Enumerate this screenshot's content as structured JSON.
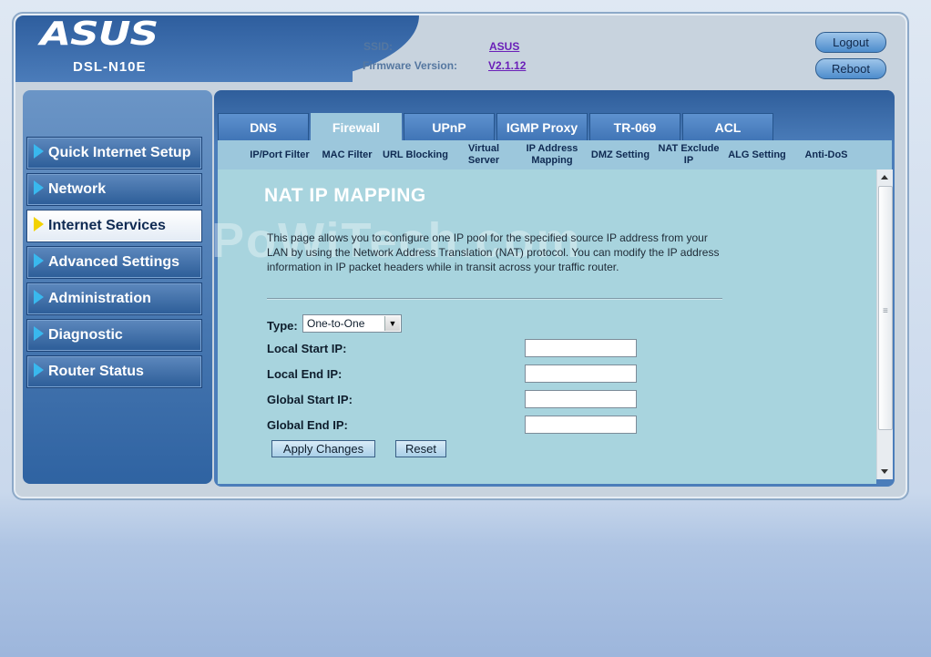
{
  "header": {
    "brand": "ASUS",
    "model": "DSL-N10E",
    "ssid_label": "SSID:",
    "ssid_value": "ASUS",
    "firmware_label": "Firmware Version:",
    "firmware_value": "V2.1.12",
    "logout_label": "Logout",
    "reboot_label": "Reboot"
  },
  "sidebar": {
    "items": [
      {
        "label": "Quick Internet Setup"
      },
      {
        "label": "Network"
      },
      {
        "label": "Internet Services"
      },
      {
        "label": "Advanced Settings"
      },
      {
        "label": "Administration"
      },
      {
        "label": "Diagnostic"
      },
      {
        "label": "Router Status"
      }
    ],
    "active_item": "Internet Services"
  },
  "tabs": [
    {
      "label": "DNS"
    },
    {
      "label": "Firewall"
    },
    {
      "label": "UPnP"
    },
    {
      "label": "IGMP Proxy"
    },
    {
      "label": "TR-069"
    },
    {
      "label": "ACL"
    }
  ],
  "active_tab": "Firewall",
  "subnav": [
    {
      "label": "IP/Port Filter"
    },
    {
      "label": "MAC Filter"
    },
    {
      "label": "URL Blocking"
    },
    {
      "label": "Virtual Server"
    },
    {
      "label": "IP Address Mapping"
    },
    {
      "label": "DMZ Setting"
    },
    {
      "label": "NAT Exclude IP"
    },
    {
      "label": "ALG Setting"
    },
    {
      "label": "Anti-DoS"
    }
  ],
  "main": {
    "title": "NAT IP MAPPING",
    "watermark": "PoWiTech.com",
    "description": "This page allows you to configure one IP pool for the specified source IP address from your LAN by using the Network Address Translation (NAT) protocol. You can modify the IP address information in IP packet headers while in transit across your traffic router.",
    "type_label": "Type:",
    "type_value": "One-to-One",
    "local_start_label": "Local Start IP:",
    "local_end_label": "Local End IP:",
    "global_start_label": "Global Start IP:",
    "global_end_label": "Global End IP:",
    "local_start_value": "",
    "local_end_value": "",
    "global_start_value": "",
    "global_end_value": "",
    "apply_label": "Apply Changes",
    "reset_label": "Reset"
  },
  "colors": {
    "brand_blue": "#2e5e9e",
    "content_bg": "#a8d4de",
    "active_arrow": "#f2d200",
    "menu_arrow": "#39b8ee"
  }
}
